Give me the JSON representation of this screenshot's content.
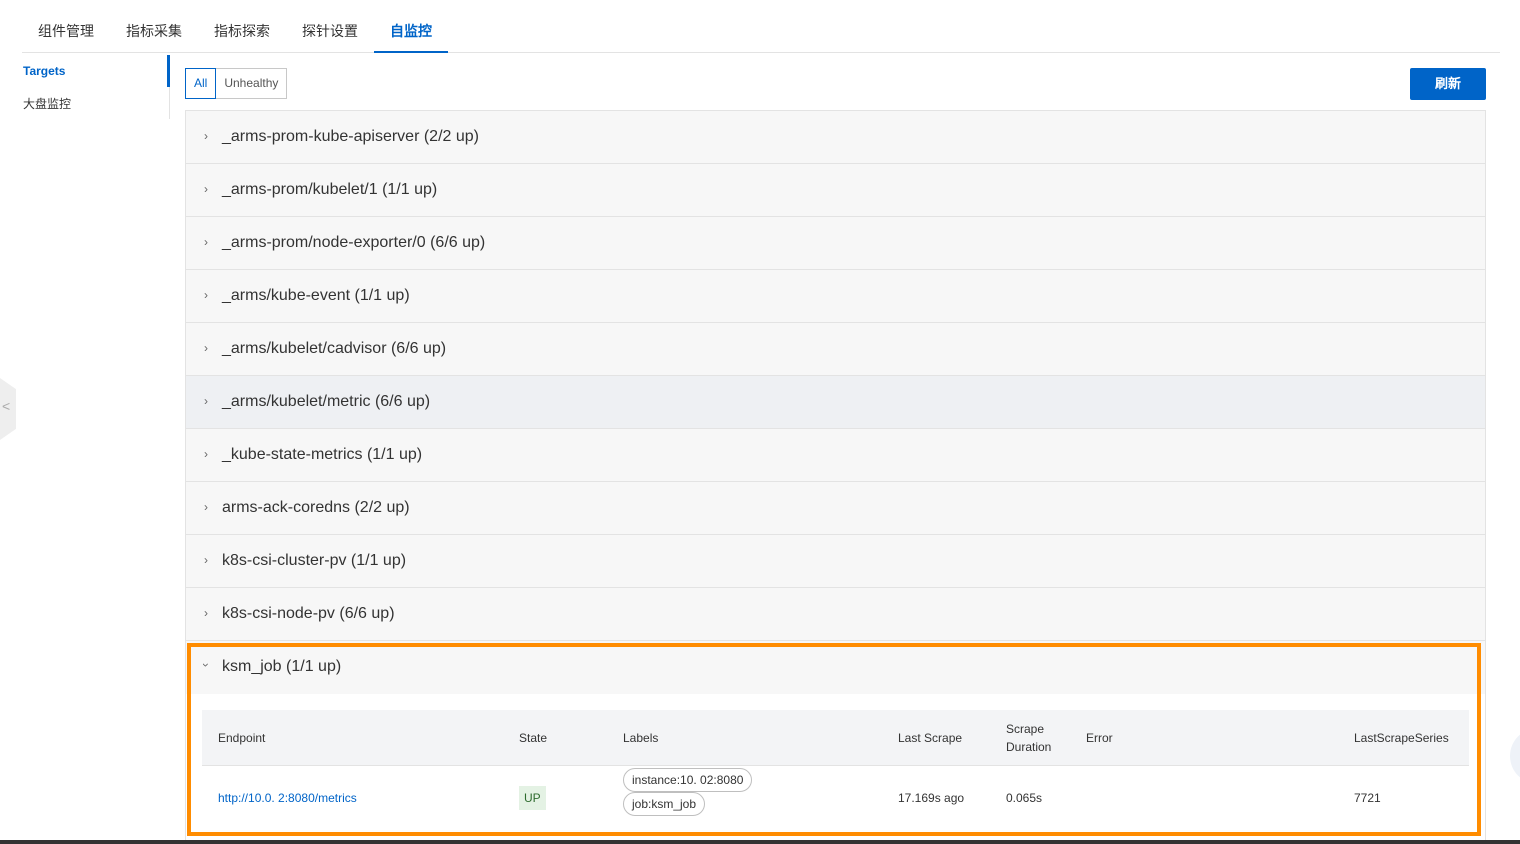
{
  "tabs": [
    {
      "label": "组件管理"
    },
    {
      "label": "指标采集"
    },
    {
      "label": "指标探索"
    },
    {
      "label": "探针设置"
    },
    {
      "label": "自监控",
      "active": true
    }
  ],
  "sidebar": {
    "items": [
      {
        "label": "Targets",
        "active": true
      },
      {
        "label": "大盘监控"
      }
    ]
  },
  "filter": {
    "all_label": "All",
    "unhealthy_label": "Unhealthy",
    "selected": "All"
  },
  "refresh_label": "刷新",
  "jobs": [
    {
      "title": "_arms-prom-kube-apiserver (2/2 up)"
    },
    {
      "title": "_arms-prom/kubelet/1 (1/1 up)"
    },
    {
      "title": "_arms-prom/node-exporter/0 (6/6 up)"
    },
    {
      "title": "_arms/kube-event (1/1 up)"
    },
    {
      "title": "_arms/kubelet/cadvisor (6/6 up)"
    },
    {
      "title": "_arms/kubelet/metric (6/6 up)"
    },
    {
      "title": "_kube-state-metrics (1/1 up)"
    },
    {
      "title": "arms-ack-coredns (2/2 up)"
    },
    {
      "title": "k8s-csi-cluster-pv (1/1 up)"
    },
    {
      "title": "k8s-csi-node-pv (6/6 up)"
    }
  ],
  "expanded_job": {
    "title": "ksm_job (1/1 up)",
    "columns": {
      "endpoint": "Endpoint",
      "state": "State",
      "labels": "Labels",
      "last_scrape": "Last Scrape",
      "scrape_duration_1": "Scrape",
      "scrape_duration_2": "Duration",
      "error": "Error",
      "last_scrape_series": "LastScrapeSeries"
    },
    "row": {
      "endpoint": "http://10.0.         2:8080/metrics",
      "state": "UP",
      "labels": [
        "instance:10.           02:8080",
        "job:ksm_job"
      ],
      "last_scrape": "17.169s ago",
      "scrape_duration": "0.065s",
      "error": "",
      "last_scrape_series": "7721"
    }
  },
  "colors": {
    "accent": "#0064c8",
    "highlight": "#ff8c00",
    "state_up_bg": "#e4f2e4"
  }
}
